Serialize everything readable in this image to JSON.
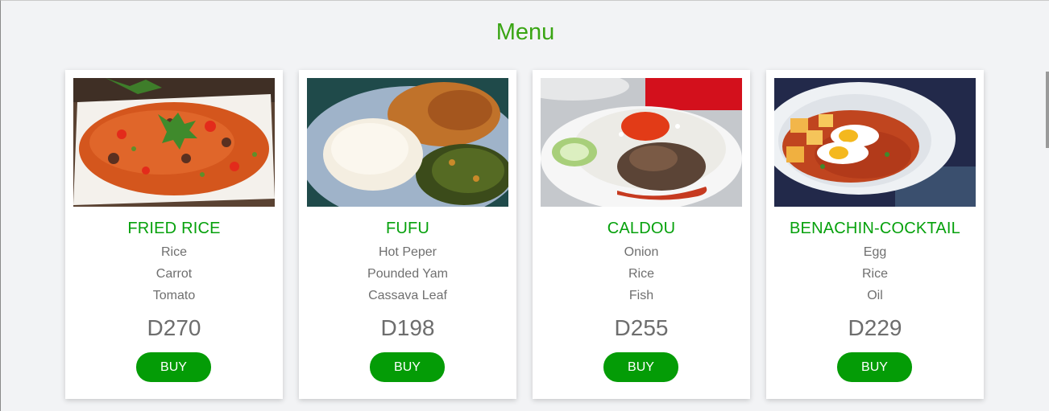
{
  "page": {
    "title": "Menu"
  },
  "menu": {
    "items": [
      {
        "name": "FRIED RICE",
        "ingredients": [
          "Rice",
          "Carrot",
          "Tomato"
        ],
        "price": "D270",
        "button": "BUY",
        "image": "fried-rice-photo"
      },
      {
        "name": "FUFU",
        "ingredients": [
          "Hot Peper",
          "Pounded Yam",
          "Cassava Leaf"
        ],
        "price": "D198",
        "button": "BUY",
        "image": "fufu-photo"
      },
      {
        "name": "CALDOU",
        "ingredients": [
          "Onion",
          "Rice",
          "Fish"
        ],
        "price": "D255",
        "button": "BUY",
        "image": "caldou-photo"
      },
      {
        "name": "BENACHIN-COCKTAIL",
        "ingredients": [
          "Egg",
          "Rice",
          "Oil"
        ],
        "price": "D229",
        "button": "BUY",
        "image": "benachin-cocktail-photo"
      }
    ]
  },
  "colors": {
    "title": "#3aa514",
    "dish_name": "#06a10c",
    "button": "#049c06",
    "background": "#f2f3f5"
  }
}
